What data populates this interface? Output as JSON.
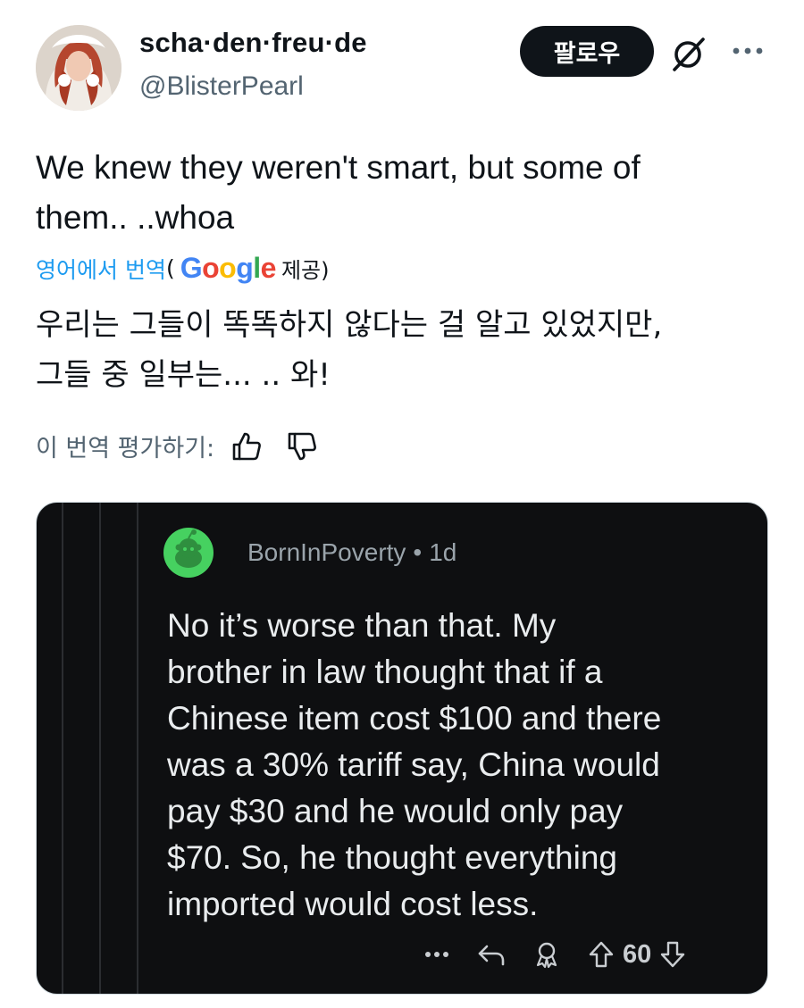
{
  "tweet": {
    "author": {
      "display_name": "scha·den·freu·de",
      "handle": "@BlisterPearl"
    },
    "follow_label": "팔로우",
    "text": "We knew they weren't smart, but some of\nthem..  ..whoa",
    "translation": {
      "link_label": "영어에서 번역",
      "open_paren": "(",
      "provider_letters": [
        "G",
        "o",
        "o",
        "g",
        "l",
        "e"
      ],
      "provided_label": "제공)",
      "text": "우리는 그들이 똑똑하지 않다는 걸 알고 있었지만,\n그들 중 일부는...  .. 와!",
      "rate_label": "이 번역 평가하기:"
    }
  },
  "embedded_comment": {
    "username": "BornInPoverty",
    "separator": "•",
    "age": "1d",
    "body": "No it’s worse than that. My\nbrother in law thought that if a\nChinese item cost $100 and there\nwas a 30% tariff say, China would\npay $30 and he would only pay\n$70. So, he thought everything\nimported would cost less.",
    "vote_count": "60"
  },
  "icons": {
    "more": "more-horizontal-icon",
    "grok": "grok-icon",
    "thumbs_up": "thumbs-up-icon",
    "thumbs_down": "thumbs-down-icon",
    "reply": "reply-icon",
    "award": "award-icon",
    "upvote": "upvote-icon",
    "downvote": "downvote-icon"
  },
  "colors": {
    "link_blue": "#1d9bf0",
    "follow_bg": "#0f1419",
    "muted_text": "#536471",
    "media_bg": "#0e0f11",
    "reddit_avatar_green": "#46d160"
  }
}
